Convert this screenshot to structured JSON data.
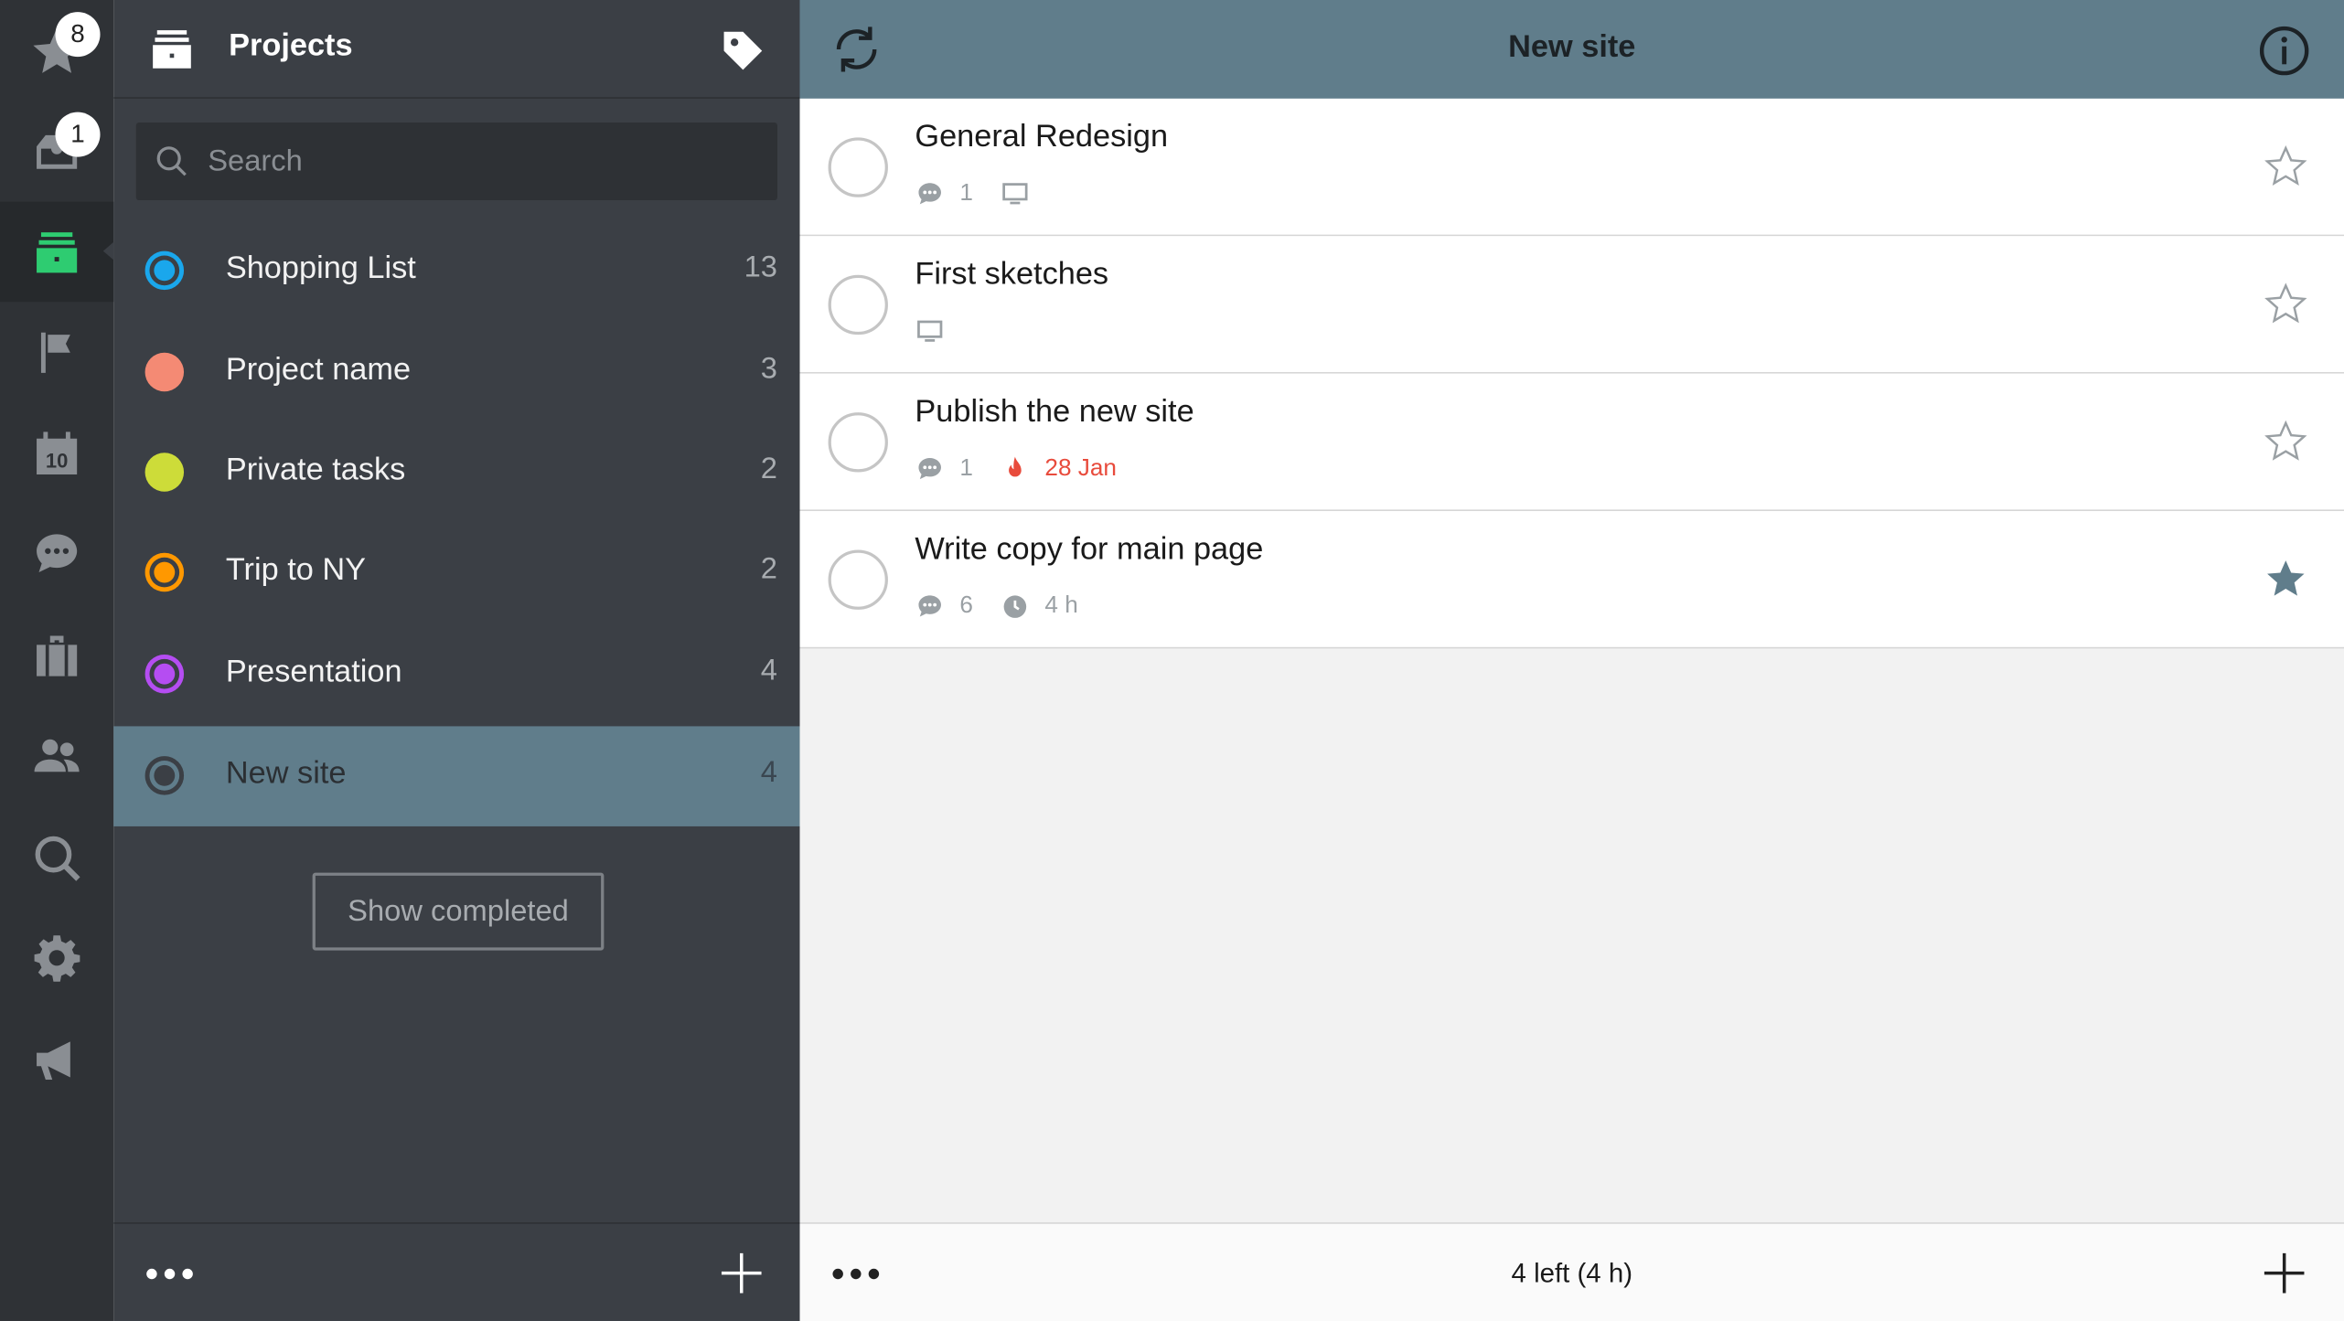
{
  "rail": {
    "favorites_badge": "8",
    "inbox_badge": "1",
    "items": [
      "star-icon",
      "inbox-icon",
      "projects-icon",
      "flag-icon",
      "calendar-icon",
      "chat-icon",
      "briefcase-icon",
      "people-icon",
      "search-icon",
      "gear-icon",
      "megaphone-icon"
    ],
    "calendar_day": "10"
  },
  "projects_panel": {
    "title": "Projects",
    "search_placeholder": "Search",
    "items": [
      {
        "name": "Shopping List",
        "count": "13",
        "color": "#1aa7ec",
        "style": "ring"
      },
      {
        "name": "Project name",
        "count": "3",
        "color": "#f48a74",
        "style": "solid"
      },
      {
        "name": "Private tasks",
        "count": "2",
        "color": "#cddc39",
        "style": "solid"
      },
      {
        "name": "Trip to NY",
        "count": "2",
        "color": "#ff9800",
        "style": "ring"
      },
      {
        "name": "Presentation",
        "count": "4",
        "color": "#b54df2",
        "style": "ring"
      },
      {
        "name": "New site",
        "count": "4",
        "color": "#3b3f45",
        "style": "ring",
        "active": true
      }
    ],
    "show_completed_label": "Show completed"
  },
  "main": {
    "title": "New site",
    "tasks": [
      {
        "title": "General Redesign",
        "comments": "1",
        "has_device": true,
        "due": "",
        "duration": "",
        "starred": false
      },
      {
        "title": "First sketches",
        "comments": "",
        "has_device": true,
        "due": "",
        "duration": "",
        "starred": false
      },
      {
        "title": "Publish the new site",
        "comments": "1",
        "has_device": false,
        "due": "28 Jan",
        "duration": "",
        "starred": false
      },
      {
        "title": "Write copy for main page",
        "comments": "6",
        "has_device": false,
        "due": "",
        "duration": "4 h",
        "starred": true
      }
    ],
    "footer_status": "4 left (4 h)"
  },
  "colors": {
    "accent": "#607d8b",
    "rail_bg": "#2f3236",
    "panel_bg": "#3b3f45",
    "active_icon": "#2ecc71",
    "due": "#e84b3c"
  }
}
